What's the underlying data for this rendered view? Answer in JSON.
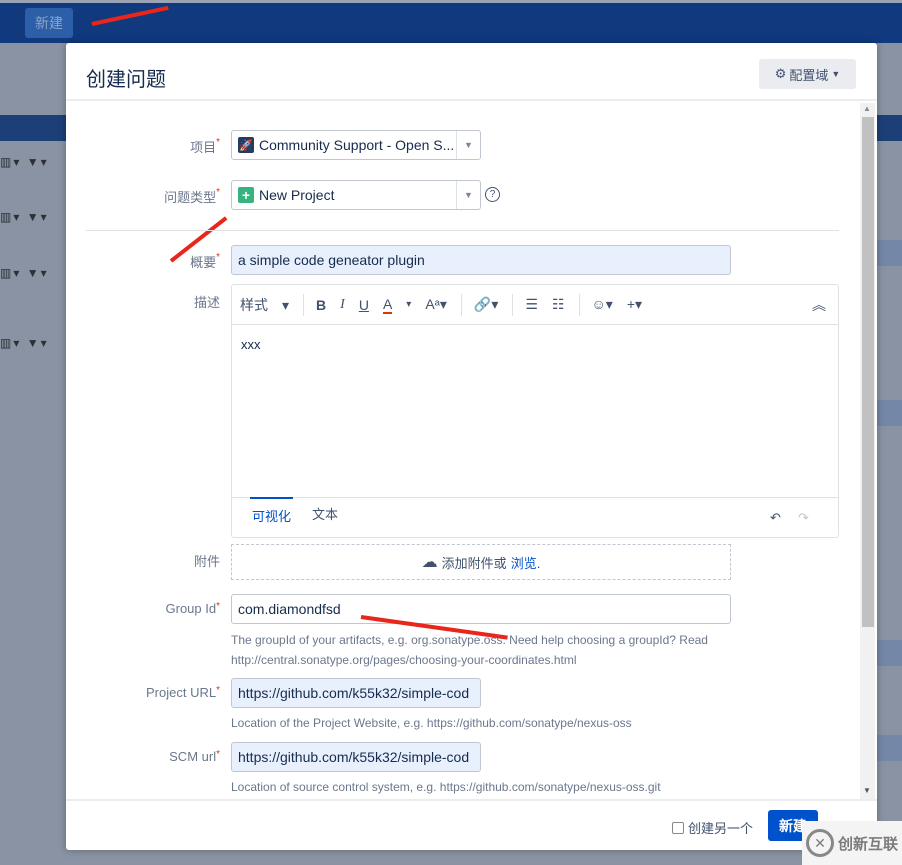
{
  "topbar": {
    "new_button": "新建"
  },
  "dialog": {
    "title": "创建问题",
    "configure_button": "配置域",
    "fields": {
      "project": {
        "label": "项目",
        "value": "Community Support - Open S..."
      },
      "issue_type": {
        "label": "问题类型",
        "value": "New Project"
      },
      "summary": {
        "label": "概要",
        "value": "a simple code geneator plugin"
      },
      "description": {
        "label": "描述",
        "content": "xxx",
        "toolbar": {
          "style": "样式"
        },
        "tabs": [
          "可视化",
          "文本"
        ]
      },
      "attachment": {
        "label": "附件",
        "drop_text": "添加附件或",
        "browse": "浏览."
      },
      "group_id": {
        "label": "Group Id",
        "value": "com.diamondfsd",
        "help_line1": "The groupId of your artifacts, e.g. org.sonatype.oss. Need help choosing a groupId? Read",
        "help_line2": "http://central.sonatype.org/pages/choosing-your-coordinates.html"
      },
      "project_url": {
        "label": "Project URL",
        "value": "https://github.com/k55k32/simple-cod",
        "help": "Location of the Project Website, e.g. https://github.com/sonatype/nexus-oss"
      },
      "scm_url": {
        "label": "SCM url",
        "value": "https://github.com/k55k32/simple-cod",
        "help": "Location of source control system, e.g. https://github.com/sonatype/nexus-oss.git"
      }
    },
    "footer": {
      "create_another": "创建另一个",
      "submit": "新建"
    }
  },
  "watermark": "创新互联",
  "colors": {
    "accent": "#0052cc",
    "topbar": "#10397e",
    "annotation_arrow": "#e8261c"
  }
}
